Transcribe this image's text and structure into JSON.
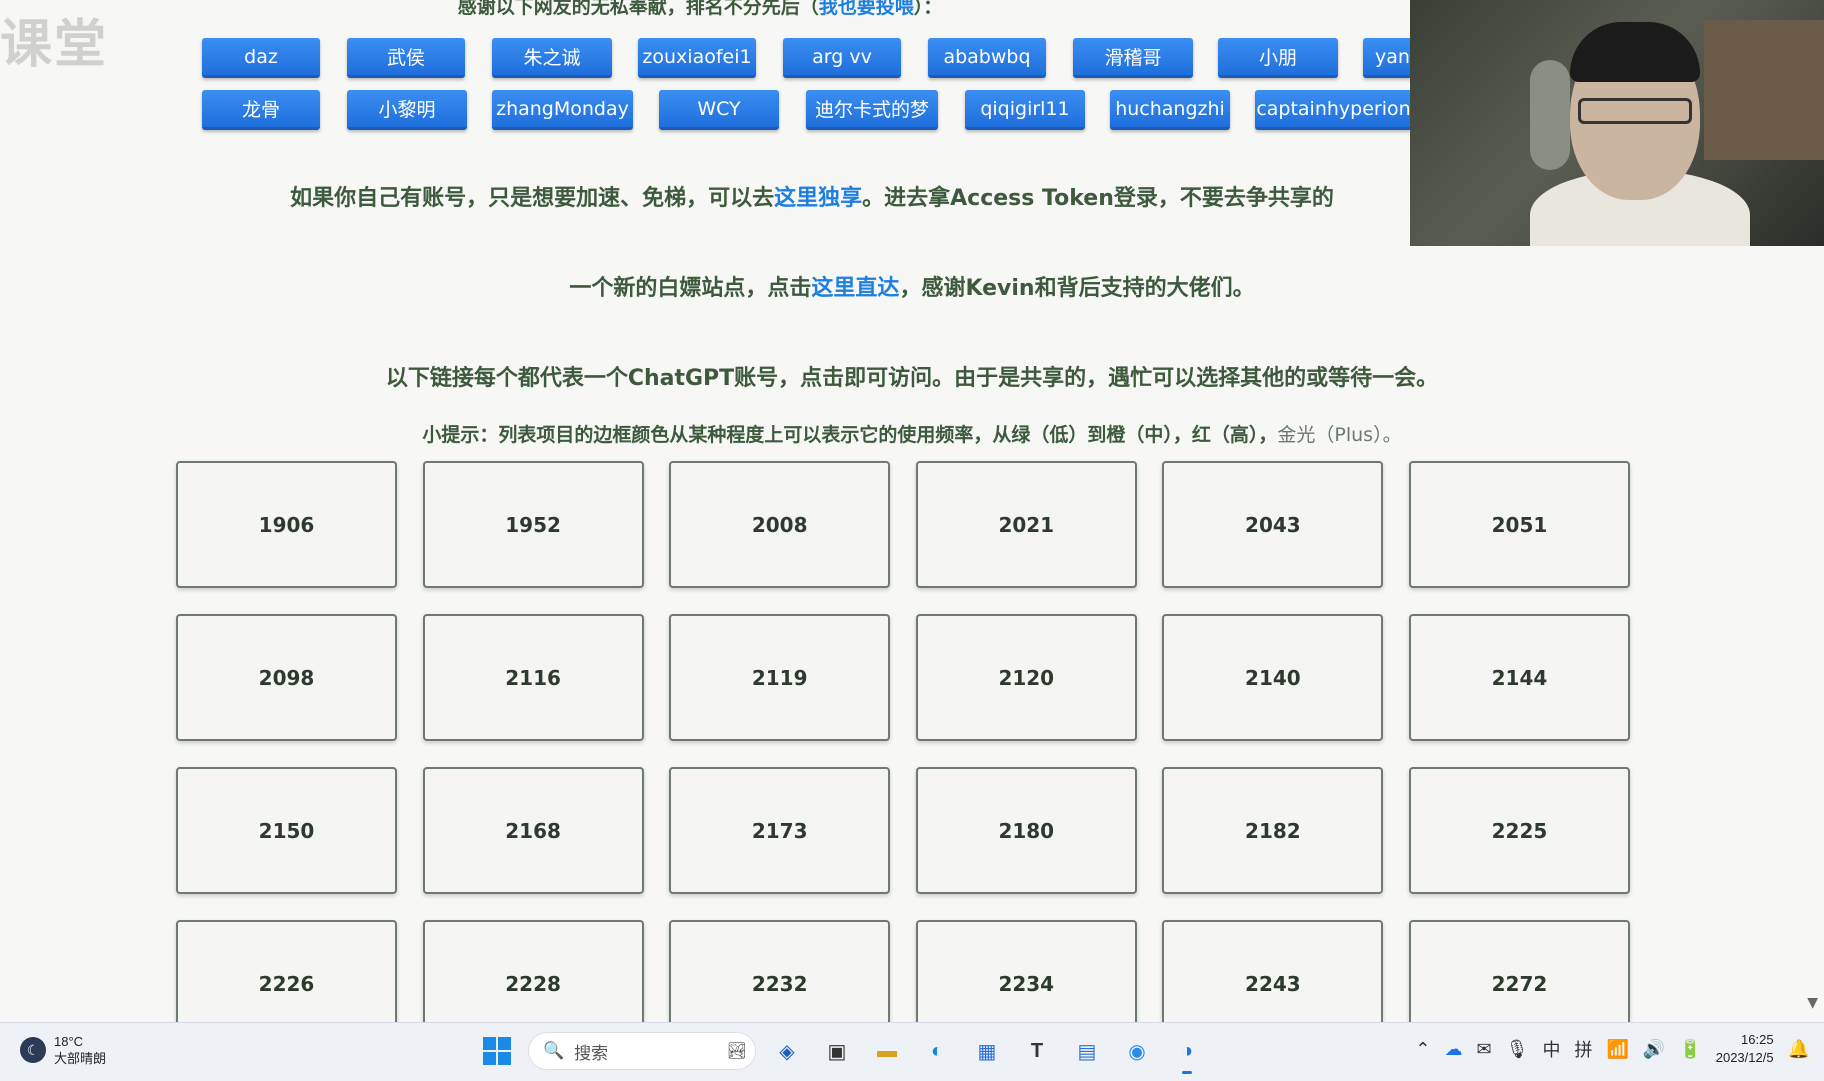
{
  "watermark": "课堂",
  "header": {
    "thanks_text": "感谢以下网友的无私奉献，排名不分先后（",
    "thanks_link": "我也要投喂",
    "thanks_end": "）："
  },
  "donors": {
    "row1": [
      "daz",
      "武侯",
      "朱之诚",
      "zouxiaofei1",
      "arg vv",
      "ababwbq",
      "滑稽哥",
      "小朋",
      "yan"
    ],
    "row2": [
      "龙骨",
      "小黎明",
      "zhangMonday",
      "WCY",
      "迪尔卡式的梦",
      "qiqigirl11",
      "huchangzhi",
      "captainhyperion"
    ]
  },
  "para1": {
    "before": "如果你自己有账号，只是想要加速、免梯，可以去",
    "link": "这里独享",
    "after": "。进去拿Access Token登录，不要去争共享的"
  },
  "para2": {
    "before": "一个新的白嫖站点，点击",
    "link": "这里直达",
    "after": "，感谢Kevin和背后支持的大佬们。"
  },
  "para3": "以下链接每个都代表一个ChatGPT账号，点击即可访问。由于是共享的，遇忙可以选择其他的或等待一会。",
  "tip": {
    "main": "小提示：列表项目的边框颜色从某种程度上可以表示它的使用频率，从绿（低）到橙（中），红（高），",
    "muted": "金光（Plus）。"
  },
  "accounts": [
    "1906",
    "1952",
    "2008",
    "2021",
    "2043",
    "2051",
    "2098",
    "2116",
    "2119",
    "2120",
    "2140",
    "2144",
    "2150",
    "2168",
    "2173",
    "2180",
    "2182",
    "2225",
    "2226",
    "2228",
    "2232",
    "2234",
    "2243",
    "2272"
  ],
  "taskbar": {
    "temperature": "18°C",
    "weather": "大部晴朗",
    "search_placeholder": "搜索",
    "ime_lang": "中",
    "ime_mode": "拼",
    "time": "16:25",
    "date": "2023/12/5"
  }
}
